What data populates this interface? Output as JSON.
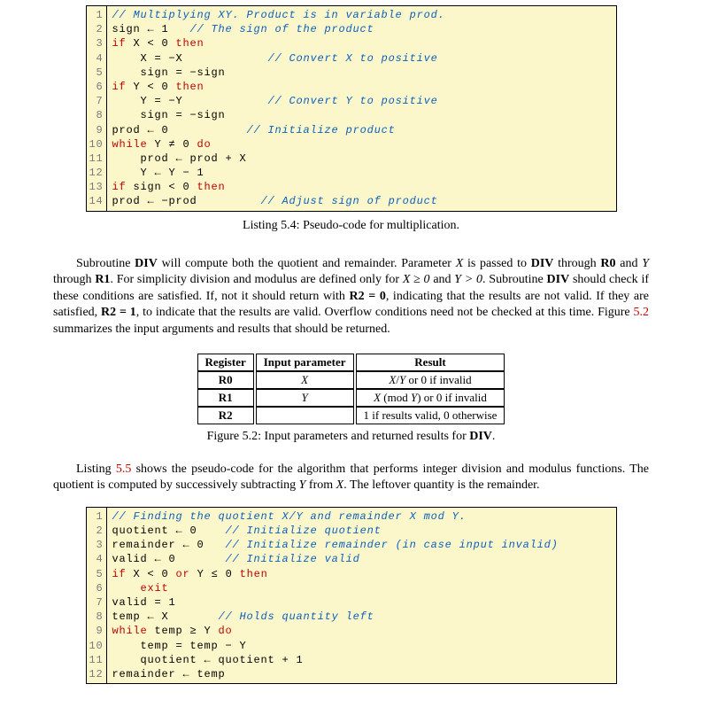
{
  "listing1": {
    "caption": "Listing 5.4: Pseudo-code for multiplication.",
    "lines": [
      {
        "n": "1",
        "segs": [
          {
            "t": "// Multiplying XY. Product is in variable prod.",
            "c": "cmt"
          }
        ]
      },
      {
        "n": "2",
        "segs": [
          {
            "t": "sign ← 1   ",
            "c": "plain"
          },
          {
            "t": "// The sign of the product",
            "c": "cmt"
          }
        ]
      },
      {
        "n": "3",
        "segs": [
          {
            "t": "if",
            "c": "kw"
          },
          {
            "t": " X < 0 ",
            "c": "plain"
          },
          {
            "t": "then",
            "c": "kw"
          }
        ]
      },
      {
        "n": "4",
        "segs": [
          {
            "t": "    X = −X            ",
            "c": "plain"
          },
          {
            "t": "// Convert X to positive",
            "c": "cmt"
          }
        ]
      },
      {
        "n": "5",
        "segs": [
          {
            "t": "    sign = −sign",
            "c": "plain"
          }
        ]
      },
      {
        "n": "6",
        "segs": [
          {
            "t": "if",
            "c": "kw"
          },
          {
            "t": " Y < 0 ",
            "c": "plain"
          },
          {
            "t": "then",
            "c": "kw"
          }
        ]
      },
      {
        "n": "7",
        "segs": [
          {
            "t": "    Y = −Y            ",
            "c": "plain"
          },
          {
            "t": "// Convert Y to positive",
            "c": "cmt"
          }
        ]
      },
      {
        "n": "8",
        "segs": [
          {
            "t": "    sign = −sign",
            "c": "plain"
          }
        ]
      },
      {
        "n": "9",
        "segs": [
          {
            "t": "prod ← 0           ",
            "c": "plain"
          },
          {
            "t": "// Initialize product",
            "c": "cmt"
          }
        ]
      },
      {
        "n": "10",
        "segs": [
          {
            "t": "while",
            "c": "kw"
          },
          {
            "t": " Y ≠ 0 ",
            "c": "plain"
          },
          {
            "t": "do",
            "c": "kw"
          }
        ]
      },
      {
        "n": "11",
        "segs": [
          {
            "t": "    prod ← prod + X",
            "c": "plain"
          }
        ]
      },
      {
        "n": "12",
        "segs": [
          {
            "t": "    Y ← Y − 1",
            "c": "plain"
          }
        ]
      },
      {
        "n": "13",
        "segs": [
          {
            "t": "if",
            "c": "kw"
          },
          {
            "t": " sign < 0 ",
            "c": "plain"
          },
          {
            "t": "then",
            "c": "kw"
          }
        ]
      },
      {
        "n": "14",
        "segs": [
          {
            "t": "prod ← −prod         ",
            "c": "plain"
          },
          {
            "t": "// Adjust sign of product",
            "c": "cmt"
          }
        ]
      }
    ]
  },
  "paragraph1": {
    "pre": "Subroutine ",
    "div1": "DIV",
    "mid1": " will compute both the quotient and remainder. Parameter ",
    "X": "X",
    "mid2": " is passed to ",
    "div2": "DIV",
    "mid3": " through ",
    "R0": "R0",
    "mid4": " and ",
    "Y": "Y",
    "mid5": " through ",
    "R1": "R1",
    "mid6": ". For simplicity division and modulus are defined only for ",
    "cond1": "X ≥ 0",
    "mid7": " and ",
    "cond2": "Y > 0",
    "mid8": ". Subroutine ",
    "div3": "DIV",
    "mid9": " should check if these conditions are satisfied. If, not it should return with ",
    "R2a": "R2 = 0",
    "mid10": ", indicating that the results are not valid. If they are satisfied, ",
    "R2b": "R2 = 1",
    "mid11": ", to indicate that the results are valid. Overflow conditions need not be checked at this time. Figure ",
    "figref": "5.2",
    "mid12": " summarizes the input arguments and results that should be returned."
  },
  "table": {
    "headers": [
      "Register",
      "Input parameter",
      "Result"
    ],
    "rows": [
      {
        "reg": "R0",
        "in": "X",
        "out": "X/Y or 0 if invalid",
        "outItalic": [
          "X",
          "Y"
        ]
      },
      {
        "reg": "R1",
        "in": "Y",
        "out": "X (mod Y) or 0 if invalid",
        "outItalic": [
          "X",
          "Y"
        ]
      },
      {
        "reg": "R2",
        "in": "",
        "out": "1 if results valid, 0 otherwise"
      }
    ],
    "caption_pre": "Figure 5.2: Input parameters and returned results for ",
    "caption_bold": "DIV",
    "caption_post": "."
  },
  "paragraph2": {
    "pre": "Listing ",
    "lref": "5.5",
    "mid1": " shows the pseudo-code for the algorithm that performs integer division and modulus functions. The quotient is computed by successively subtracting ",
    "Y": "Y",
    "mid2": " from ",
    "X": "X",
    "mid3": ". The leftover quantity is the remainder."
  },
  "listing2": {
    "lines": [
      {
        "n": "1",
        "segs": [
          {
            "t": "// Finding the quotient X/Y and remainder X mod Y.",
            "c": "cmt"
          }
        ]
      },
      {
        "n": "2",
        "segs": [
          {
            "t": "quotient ← 0    ",
            "c": "plain"
          },
          {
            "t": "// Initialize quotient",
            "c": "cmt"
          }
        ]
      },
      {
        "n": "3",
        "segs": [
          {
            "t": "remainder ← 0   ",
            "c": "plain"
          },
          {
            "t": "// Initialize remainder (in case input invalid)",
            "c": "cmt"
          }
        ]
      },
      {
        "n": "4",
        "segs": [
          {
            "t": "valid ← 0       ",
            "c": "plain"
          },
          {
            "t": "// Initialize valid",
            "c": "cmt"
          }
        ]
      },
      {
        "n": "5",
        "segs": [
          {
            "t": "if",
            "c": "kw"
          },
          {
            "t": " X < 0 ",
            "c": "plain"
          },
          {
            "t": "or",
            "c": "kw"
          },
          {
            "t": " Y ≤ 0 ",
            "c": "plain"
          },
          {
            "t": "then",
            "c": "kw"
          }
        ]
      },
      {
        "n": "6",
        "segs": [
          {
            "t": "    exit",
            "c": "kw"
          }
        ]
      },
      {
        "n": "7",
        "segs": [
          {
            "t": "valid = 1",
            "c": "plain"
          }
        ]
      },
      {
        "n": "8",
        "segs": [
          {
            "t": "temp ← X       ",
            "c": "plain"
          },
          {
            "t": "// Holds quantity left",
            "c": "cmt"
          }
        ]
      },
      {
        "n": "9",
        "segs": [
          {
            "t": "while",
            "c": "kw"
          },
          {
            "t": " temp ≥ Y ",
            "c": "plain"
          },
          {
            "t": "do",
            "c": "kw"
          }
        ]
      },
      {
        "n": "10",
        "segs": [
          {
            "t": "    temp = temp − Y",
            "c": "plain"
          }
        ]
      },
      {
        "n": "11",
        "segs": [
          {
            "t": "    quotient ← quotient + 1",
            "c": "plain"
          }
        ]
      },
      {
        "n": "12",
        "segs": [
          {
            "t": "remainder ← temp",
            "c": "plain"
          }
        ]
      }
    ]
  }
}
